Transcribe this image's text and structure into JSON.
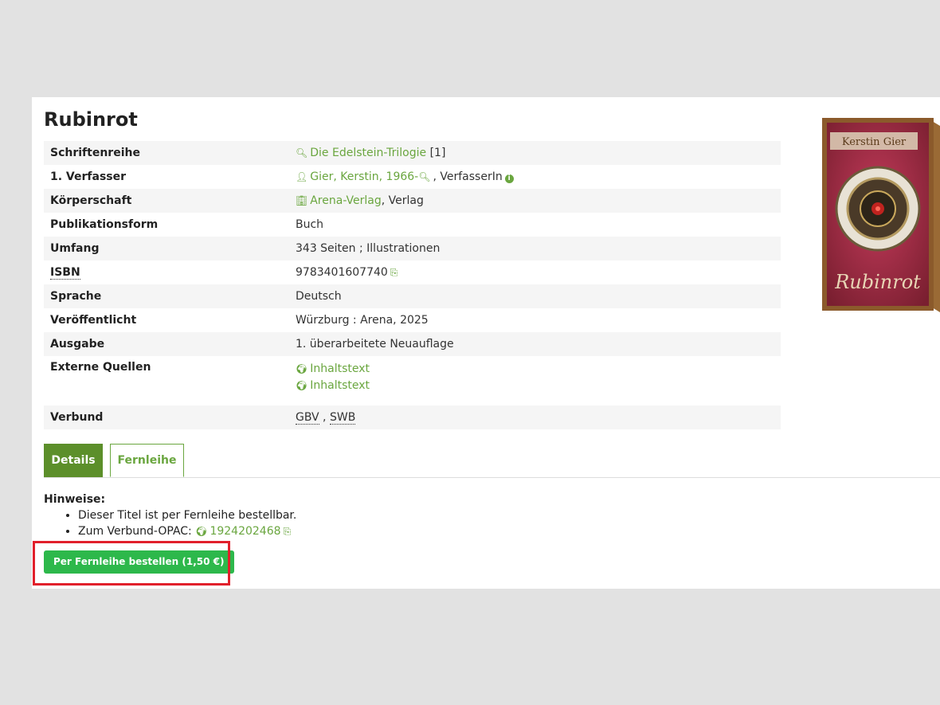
{
  "record": {
    "title": "Rubinrot",
    "rows": {
      "series": {
        "label": "Schriftenreihe",
        "link": "Die Edelstein-Trilogie",
        "suffix": "[1]"
      },
      "author": {
        "label": "1. Verfasser",
        "link": "Gier, Kerstin, 1966-",
        "role": ", VerfasserIn"
      },
      "corporate": {
        "label": "Körperschaft",
        "link": "Arena-Verlag",
        "role": ", Verlag"
      },
      "pubform": {
        "label": "Publikationsform",
        "value": "Buch"
      },
      "extent": {
        "label": "Umfang",
        "value": "343 Seiten ; Illustrationen"
      },
      "isbn": {
        "label": "ISBN",
        "value": "9783401607740"
      },
      "language": {
        "label": "Sprache",
        "value": "Deutsch"
      },
      "published": {
        "label": "Veröffentlicht",
        "value": "Würzburg : Arena, 2025"
      },
      "edition": {
        "label": "Ausgabe",
        "value": "1. überarbeitete Neuauflage"
      },
      "external": {
        "label": "Externe Quellen",
        "links": [
          "Inhaltstext",
          "Inhaltstext"
        ]
      },
      "network": {
        "label": "Verbund",
        "gbv": "GBV",
        "sep": " , ",
        "swb": "SWB"
      }
    }
  },
  "cover": {
    "author_text": "Kerstin Gier",
    "title_text": "Rubinrot"
  },
  "tabs": {
    "details": "Details",
    "fernleihe": "Fernleihe"
  },
  "notes": {
    "title": "Hinweise:",
    "item1": "Dieser Titel ist per Fernleihe bestellbar.",
    "item2_prefix": "Zum Verbund-OPAC: ",
    "item2_link": "1924202468"
  },
  "order_button": "Per Fernleihe bestellen (1,50 €)",
  "colors": {
    "link": "#6aa63f",
    "tab_active": "#5c8f2a",
    "button": "#2db84b",
    "highlight": "#e1202b"
  },
  "icons": [
    "search-icon",
    "user-icon",
    "info-icon",
    "building-icon",
    "copy-icon",
    "globe-icon"
  ]
}
